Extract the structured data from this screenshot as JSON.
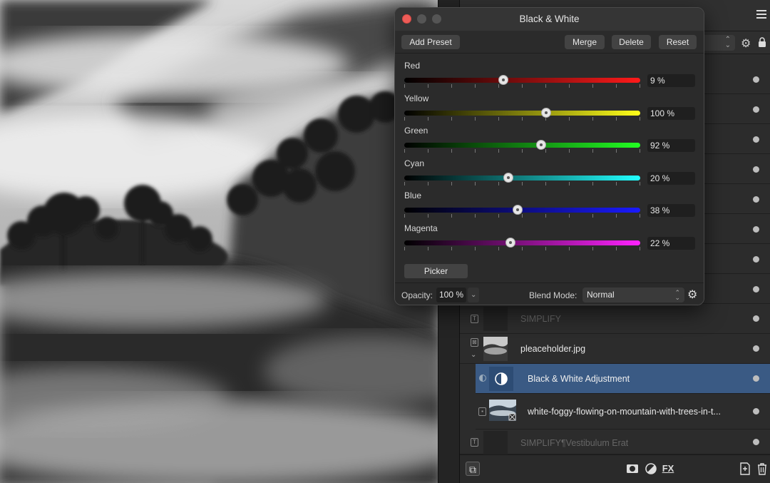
{
  "dialog": {
    "title": "Black & White",
    "buttons": {
      "add_preset": "Add Preset",
      "merge": "Merge",
      "delete": "Delete",
      "reset": "Reset"
    },
    "sliders": [
      {
        "label": "Red",
        "value": "9 %",
        "fraction": 0.42,
        "from": "#000000",
        "to": "#ff1a1a"
      },
      {
        "label": "Yellow",
        "value": "100 %",
        "fraction": 0.6,
        "from": "#000000",
        "to": "#ffff1a"
      },
      {
        "label": "Green",
        "value": "92 %",
        "fraction": 0.58,
        "from": "#000000",
        "to": "#22ff22"
      },
      {
        "label": "Cyan",
        "value": "20 %",
        "fraction": 0.44,
        "from": "#000000",
        "to": "#22ffff"
      },
      {
        "label": "Blue",
        "value": "38 %",
        "fraction": 0.48,
        "from": "#000000",
        "to": "#1a1aff"
      },
      {
        "label": "Magenta",
        "value": "22 %",
        "fraction": 0.45,
        "from": "#000000",
        "to": "#ff22ff"
      }
    ],
    "picker": "Picker",
    "opacity_label": "Opacity:",
    "opacity_value": "100 %",
    "blend_label": "Blend Mode:",
    "blend_value": "Normal"
  },
  "layers": [
    {
      "name": "SIMPLIFY",
      "kind": "text",
      "dim": true
    },
    {
      "name": "pleaceholder.jpg",
      "kind": "image",
      "dim": false
    },
    {
      "name": "Black & White Adjustment",
      "kind": "adjustment",
      "selected": true
    },
    {
      "name": "white-foggy-flowing-on-mountain-with-trees-in-t...",
      "kind": "image",
      "dim": false
    },
    {
      "name": "SIMPLIFY¶Vestibulum Erat",
      "kind": "text",
      "dim": true
    }
  ],
  "icons": {
    "menu": "hamburger-menu-icon",
    "settings": "gear-icon",
    "lock": "lock-icon",
    "mask": "mask-icon",
    "adjustment": "adjustment-icon",
    "fx": "fx-icon",
    "new_layer": "new-layer-icon",
    "trash": "trash-icon"
  },
  "colors": {
    "accent": "#3a5a84",
    "close": "#ed5c57"
  }
}
